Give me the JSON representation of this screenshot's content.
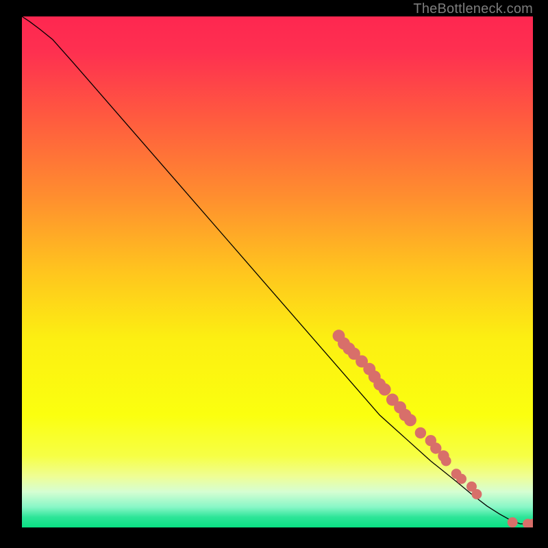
{
  "attribution": "TheBottleneck.com",
  "chart_data": {
    "type": "line",
    "title": "",
    "xlabel": "",
    "ylabel": "",
    "xlim": [
      0,
      100
    ],
    "ylim": [
      0,
      100
    ],
    "grid": false,
    "background": "rainbow-vertical",
    "series": [
      {
        "name": "curve",
        "x": [
          0.0,
          1.5,
          3.5,
          6.0,
          10.0,
          20.0,
          30.0,
          40.0,
          50.0,
          60.0,
          70.0,
          75.0,
          80.0,
          85.0,
          88.0,
          91.0,
          93.5,
          95.5,
          97.5,
          100.0
        ],
        "y": [
          100.0,
          99.0,
          97.5,
          95.5,
          91.0,
          79.5,
          68.0,
          56.5,
          45.0,
          33.5,
          22.0,
          17.5,
          13.0,
          9.0,
          6.5,
          4.2,
          2.6,
          1.5,
          0.7,
          0.7
        ]
      }
    ],
    "markers": [
      {
        "x": 62.0,
        "y": 37.5,
        "r": 1.2
      },
      {
        "x": 63.0,
        "y": 36.0,
        "r": 1.2
      },
      {
        "x": 64.0,
        "y": 35.0,
        "r": 1.2
      },
      {
        "x": 65.0,
        "y": 34.0,
        "r": 1.2
      },
      {
        "x": 66.5,
        "y": 32.5,
        "r": 1.2
      },
      {
        "x": 68.0,
        "y": 31.0,
        "r": 1.2
      },
      {
        "x": 69.0,
        "y": 29.5,
        "r": 1.2
      },
      {
        "x": 70.0,
        "y": 28.0,
        "r": 1.2
      },
      {
        "x": 71.0,
        "y": 27.0,
        "r": 1.2
      },
      {
        "x": 72.5,
        "y": 25.0,
        "r": 1.2
      },
      {
        "x": 74.0,
        "y": 23.5,
        "r": 1.2
      },
      {
        "x": 75.0,
        "y": 22.0,
        "r": 1.2
      },
      {
        "x": 76.0,
        "y": 21.0,
        "r": 1.2
      },
      {
        "x": 78.0,
        "y": 18.5,
        "r": 1.1
      },
      {
        "x": 80.0,
        "y": 17.0,
        "r": 1.1
      },
      {
        "x": 81.0,
        "y": 15.5,
        "r": 1.1
      },
      {
        "x": 82.5,
        "y": 14.0,
        "r": 1.1
      },
      {
        "x": 83.0,
        "y": 13.0,
        "r": 1.0
      },
      {
        "x": 85.0,
        "y": 10.5,
        "r": 1.0
      },
      {
        "x": 86.0,
        "y": 9.5,
        "r": 1.0
      },
      {
        "x": 88.0,
        "y": 8.0,
        "r": 1.0
      },
      {
        "x": 89.0,
        "y": 6.5,
        "r": 1.0
      },
      {
        "x": 96.0,
        "y": 1.0,
        "r": 1.0
      },
      {
        "x": 99.0,
        "y": 0.7,
        "r": 1.0
      },
      {
        "x": 100.0,
        "y": 0.7,
        "r": 1.0
      }
    ]
  },
  "palette": {
    "curve": "#000000",
    "marker_fill": "#d86f6a",
    "gradient_stops": [
      {
        "pct": 0,
        "color": "#fe2750"
      },
      {
        "pct": 7,
        "color": "#fe3050"
      },
      {
        "pct": 20,
        "color": "#ff5b3f"
      },
      {
        "pct": 35,
        "color": "#ff8d2f"
      },
      {
        "pct": 50,
        "color": "#ffc51e"
      },
      {
        "pct": 63,
        "color": "#fcef12"
      },
      {
        "pct": 78,
        "color": "#fbff0f"
      },
      {
        "pct": 86,
        "color": "#f6ff45"
      },
      {
        "pct": 90,
        "color": "#effe95"
      },
      {
        "pct": 93,
        "color": "#d6fed2"
      },
      {
        "pct": 96,
        "color": "#88f7c7"
      },
      {
        "pct": 98,
        "color": "#2de598"
      },
      {
        "pct": 100,
        "color": "#09df83"
      }
    ]
  }
}
